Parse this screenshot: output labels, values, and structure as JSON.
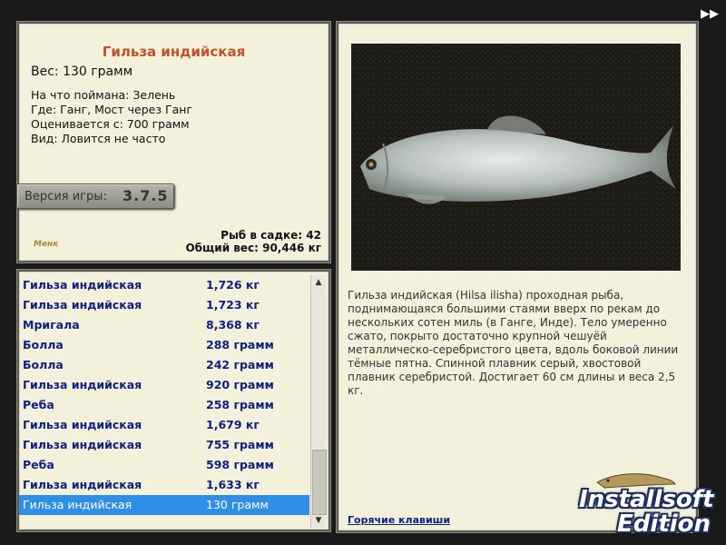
{
  "fish": {
    "title": "Гильза индийская",
    "weight": "Вес: 130 грамм",
    "caught_on": "На что поймана: Зелень",
    "location": "Где: Ганг, Мост через Ганг",
    "valued_from": "Оценивается с: 700 грамм",
    "kind": "Вид: Ловится не часто"
  },
  "version": {
    "label": "Версия игры:",
    "number": "3.7.5"
  },
  "logo_text": "Менк",
  "summary": {
    "fish_count": "Рыб в садке: 42",
    "total_weight": "Общий вес: 90,446 кг"
  },
  "catch_list": [
    {
      "name": "Гильза индийская",
      "weight": "1,726 кг"
    },
    {
      "name": "Гильза индийская",
      "weight": "1,723 кг"
    },
    {
      "name": "Мригала",
      "weight": "8,368 кг"
    },
    {
      "name": "Болла",
      "weight": "288 грамм"
    },
    {
      "name": "Болла",
      "weight": "242 грамм"
    },
    {
      "name": "Гильза индийская",
      "weight": "920 грамм"
    },
    {
      "name": "Реба",
      "weight": "258 грамм"
    },
    {
      "name": "Гильза индийская",
      "weight": "1,679 кг"
    },
    {
      "name": "Гильза индийская",
      "weight": "755 грамм"
    },
    {
      "name": "Реба",
      "weight": "598 грамм"
    },
    {
      "name": "Гильза индийская",
      "weight": "1,633 кг"
    },
    {
      "name": "Гильза индийская",
      "weight": "130 грамм",
      "selected": true
    }
  ],
  "description": "Гильза индийская (Hilsa ilisha) проходная рыба, поднимающаяся большими стаями вверх по рекам до нескольких сотен миль (в Ганге, Инде). Тело умеренно сжато, покрыто достаточно крупной чешуёй металлическо-серебристого цвета, вдоль боковой линии тёмные пятна. Спинной плавник серый, хвостовой плавник серебристой. Достигает 60 см длины и веса 2,5 кг.",
  "hotkeys_link": "Горячие клавиши",
  "watermark": {
    "line1": "Installsoft",
    "line2": "Edition"
  },
  "colors": {
    "panel_bg": "#f3f0dc",
    "title": "#c0522a",
    "list_text": "#10207f",
    "selection": "#2f8fe6"
  },
  "icons": {
    "forward": "double-arrow-right-icon",
    "scroll_up": "arrow-up-icon",
    "scroll_down": "arrow-down-icon"
  }
}
